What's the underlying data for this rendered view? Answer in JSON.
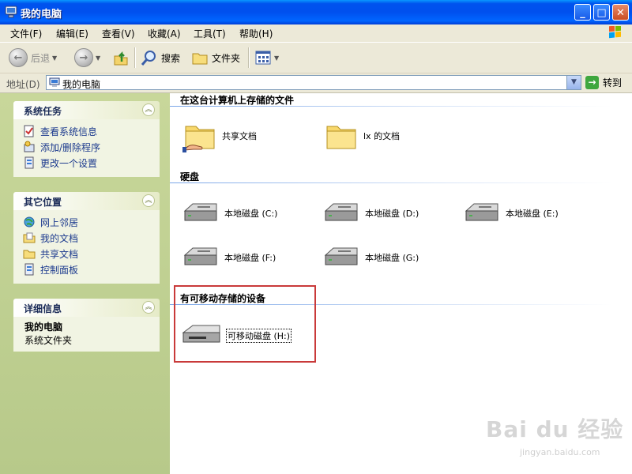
{
  "window": {
    "title": "我的电脑",
    "controls": [
      "minimize-icon",
      "maximize-icon",
      "close-icon"
    ]
  },
  "menu": [
    "文件(F)",
    "编辑(E)",
    "查看(V)",
    "收藏(A)",
    "工具(T)",
    "帮助(H)"
  ],
  "toolbar": {
    "back_label": "后退",
    "search_label": "搜索",
    "folders_label": "文件夹"
  },
  "address": {
    "label": "地址(D)",
    "value": "我的电脑",
    "go_label": "转到"
  },
  "left_panel": {
    "system_tasks": {
      "title": "系统任务",
      "items": [
        "查看系统信息",
        "添加/删除程序",
        "更改一个设置"
      ]
    },
    "other_places": {
      "title": "其它位置",
      "items": [
        "网上邻居",
        "我的文档",
        "共享文档",
        "控制面板"
      ]
    },
    "details": {
      "title": "详细信息",
      "name": "我的电脑",
      "type": "系统文件夹"
    }
  },
  "content": {
    "section_files": {
      "title": "在这台计算机上存储的文件",
      "items": [
        "共享文档",
        "lx 的文档"
      ]
    },
    "section_disks": {
      "title": "硬盘",
      "items": [
        "本地磁盘 (C:)",
        "本地磁盘 (D:)",
        "本地磁盘 (E:)",
        "本地磁盘 (F:)",
        "本地磁盘 (G:)"
      ]
    },
    "section_removable": {
      "title": "有可移动存储的设备",
      "items": [
        "可移动磁盘 (H:)"
      ]
    }
  },
  "watermark": {
    "brand": "Bai du 经验",
    "url": "jingyan.baidu.com"
  },
  "colors": {
    "titlebar": "#0053ee",
    "left_pane": "#c8d79a",
    "highlight_box": "#c93a3a"
  }
}
